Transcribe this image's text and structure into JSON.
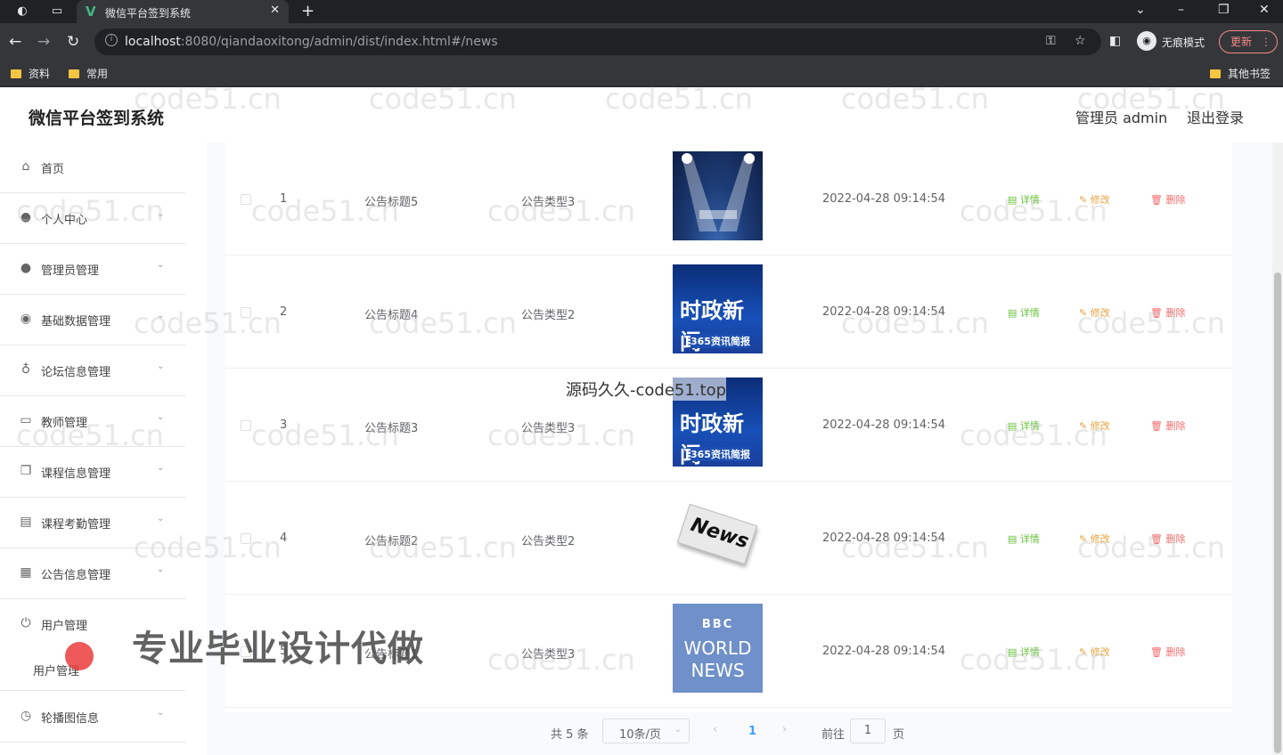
{
  "browser": {
    "tab_title": "微信平台签到系统",
    "url_host": "localhost",
    "url_path": ":8080/qiandaoxitong/admin/dist/index.html#/news",
    "incognito_label": "无痕模式",
    "update_label": "更新",
    "bookmarks": [
      "资料",
      "常用"
    ],
    "other_bookmarks": "其他书签"
  },
  "app": {
    "title": "微信平台签到系统",
    "user_label": "管理员 admin",
    "logout_label": "退出登录"
  },
  "sidebar": {
    "items": [
      {
        "label": "首页",
        "icon": "home-icon"
      },
      {
        "label": "个人中心",
        "icon": "user-icon"
      },
      {
        "label": "管理员管理",
        "icon": "user-icon"
      },
      {
        "label": "基础数据管理",
        "icon": "pin-icon"
      },
      {
        "label": "论坛信息管理",
        "icon": "mic-icon"
      },
      {
        "label": "教师管理",
        "icon": "chat-icon"
      },
      {
        "label": "课程信息管理",
        "icon": "copy-icon"
      },
      {
        "label": "课程考勤管理",
        "icon": "doc-icon"
      },
      {
        "label": "公告信息管理",
        "icon": "grid-icon"
      },
      {
        "label": "用户管理",
        "icon": "power-icon"
      }
    ],
    "sub_item": "用户管理",
    "last_item": {
      "label": "轮播图信息",
      "icon": "clock-icon"
    }
  },
  "table": {
    "rows": [
      {
        "index": "1",
        "title": "公告标题5",
        "type": "公告类型3",
        "time": "2022-04-28 09:14:54",
        "image": "stage-spotlight"
      },
      {
        "index": "2",
        "title": "公告标题4",
        "type": "公告类型2",
        "time": "2022-04-28 09:14:54",
        "image": "shizheng-xinwen"
      },
      {
        "index": "3",
        "title": "公告标题3",
        "type": "公告类型3",
        "time": "2022-04-28 09:14:54",
        "image": "shizheng-xinwen"
      },
      {
        "index": "4",
        "title": "公告标题2",
        "type": "公告类型2",
        "time": "2022-04-28 09:14:54",
        "image": "news-paper"
      },
      {
        "index": "5",
        "title": "公告标题1",
        "type": "公告类型3",
        "time": "2022-04-28 09:14:54",
        "image": "bbc-world-news"
      }
    ],
    "actions": {
      "detail": "详情",
      "edit": "修改",
      "delete": "删除"
    },
    "image_text": {
      "shizheng": "时政新闻",
      "shizheng_sub": "365资讯简报",
      "news": "News",
      "bbc": "BBC",
      "world": "WORLD",
      "news_caps": "NEWS"
    }
  },
  "pagination": {
    "total": "共 5 条",
    "page_size": "10条/页",
    "current_page": "1",
    "goto_prefix": "前往",
    "goto_value": "1",
    "goto_suffix": "页"
  },
  "overlays": {
    "source_text": "源码久久-code51.top",
    "promo_text": "专业毕业设计代做",
    "watermark": "code51.cn"
  }
}
